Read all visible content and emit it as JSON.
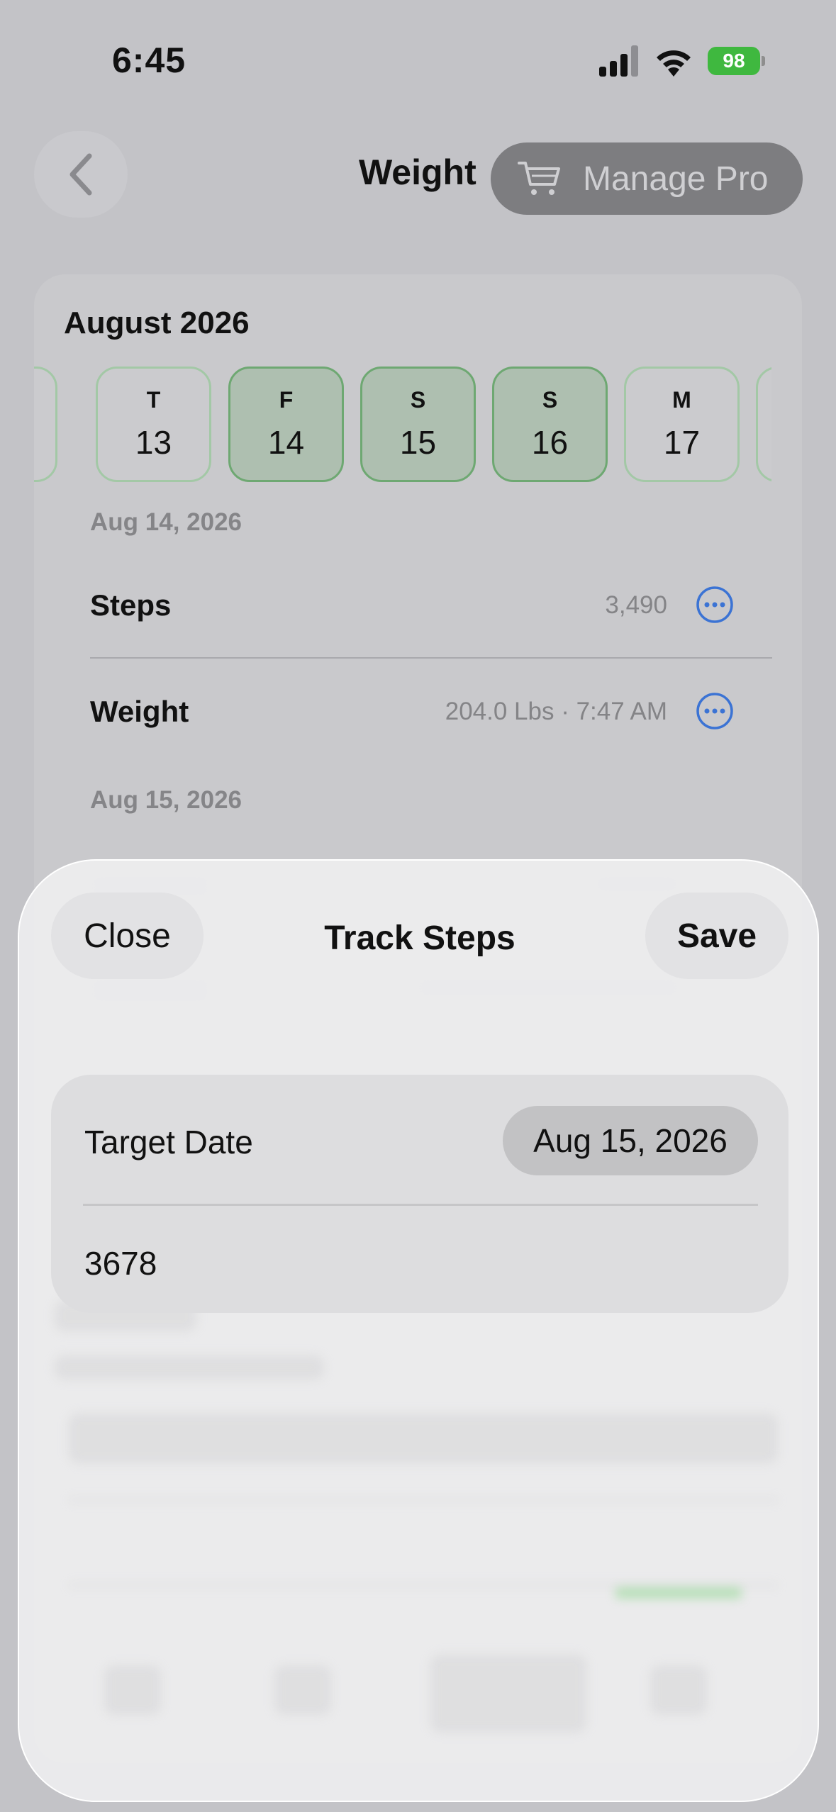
{
  "status_bar": {
    "time": "6:45",
    "battery": "98"
  },
  "nav": {
    "title": "Weight",
    "manage_pro": "Manage Pro"
  },
  "calendar": {
    "month": "August 2026",
    "days": [
      {
        "letter": "T",
        "num": "13",
        "selected": false
      },
      {
        "letter": "F",
        "num": "14",
        "selected": true
      },
      {
        "letter": "S",
        "num": "15",
        "selected": true
      },
      {
        "letter": "S",
        "num": "16",
        "selected": true
      },
      {
        "letter": "M",
        "num": "17",
        "selected": false
      }
    ]
  },
  "entries": {
    "date1": "Aug 14, 2026",
    "steps_label": "Steps",
    "steps_value": "3,490",
    "weight_label": "Weight",
    "weight_value": "204.0 Lbs · 7:47 AM",
    "date2": "Aug 15, 2026"
  },
  "sheet": {
    "close": "Close",
    "title": "Track Steps",
    "save": "Save",
    "target_label": "Target Date",
    "target_date": "Aug 15, 2026",
    "steps_value": "3678"
  },
  "colors": {
    "accent_blue": "#3b73d4",
    "selected_green": "#6ea872",
    "battery_green": "#3fb83f"
  }
}
